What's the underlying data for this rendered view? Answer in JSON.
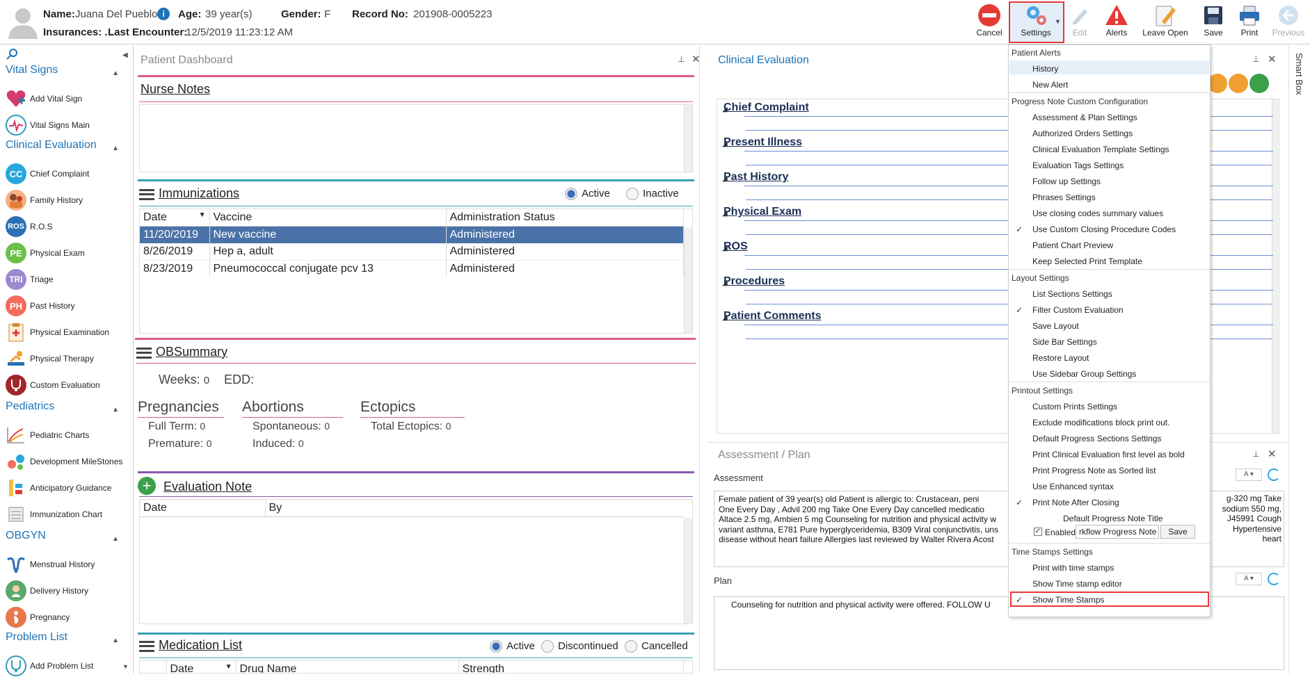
{
  "header": {
    "name_label": "Name:",
    "name_value": "Juana Del Pueblo",
    "age_label": "Age:",
    "age_value": "39 year(s)",
    "gender_label": "Gender:",
    "gender_value": "F",
    "record_label": "Record No:",
    "record_value": "201908-0005223",
    "insurances_label": "Insurances: . .",
    "last_encounter_label": "Last Encounter:",
    "last_encounter_value": "12/5/2019 11:23:12 AM"
  },
  "toolbar": {
    "cancel": "Cancel",
    "settings": "Settings",
    "edit": "Edit",
    "alerts": "Alerts",
    "leave_open": "Leave Open",
    "save": "Save",
    "print": "Print",
    "previous": "Previous"
  },
  "sidebar": {
    "vital_signs": "Vital Signs",
    "add_vital_sign": "Add Vital Sign",
    "vital_signs_main": "Vital Signs Main",
    "clinical_evaluation": "Clinical Evaluation",
    "chief_complaint": "Chief Complaint",
    "family_history": "Family History",
    "ros": "R.O.S",
    "physical_exam": "Physical Exam",
    "triage": "Triage",
    "past_history": "Past History",
    "physical_examination": "Physical Examination",
    "physical_therapy": "Physical Therapy",
    "custom_evaluation": "Custom Evaluation",
    "pediatrics": "Pediatrics",
    "pediatric_charts": "Pediatric Charts",
    "development_milestones": "Development MileStones",
    "anticipatory_guidance": "Anticipatory Guidance",
    "immunization_chart": "Immunization Chart",
    "obgyn": "OBGYN",
    "menstrual_history": "Menstrual History",
    "delivery_history": "Delivery History",
    "pregnancy": "Pregnancy",
    "problem_list": "Problem List",
    "add_problem_list": "Add Problem List",
    "icon_cc": "CC",
    "icon_ros": "ROS",
    "icon_pe": "PE",
    "icon_tri": "TRI",
    "icon_ph": "PH"
  },
  "dashboard": {
    "title": "Patient Dashboard",
    "nurse_notes": "Nurse Notes",
    "immunizations": "Immunizations",
    "active": "Active",
    "inactive": "Inactive",
    "imm_columns": [
      "Date",
      "Vaccine",
      "Administration Status"
    ],
    "imm_rows": [
      {
        "date": "11/20/2019",
        "vaccine": "New vaccine",
        "status": "Administered"
      },
      {
        "date": "8/26/2019",
        "vaccine": "Hep a, adult",
        "status": "Administered"
      },
      {
        "date": "8/23/2019",
        "vaccine": "Pneumococcal conjugate pcv 13",
        "status": "Administered"
      }
    ],
    "obsummary": "OBSummary",
    "weeks_label": "Weeks:",
    "weeks_value": "0",
    "edd_label": "EDD:",
    "pregnancies": "Pregnancies",
    "full_term_label": "Full Term:",
    "full_term_value": "0",
    "premature_label": "Premature:",
    "premature_value": "0",
    "abortions": "Abortions",
    "spontaneous_label": "Spontaneous:",
    "spontaneous_value": "0",
    "induced_label": "Induced:",
    "induced_value": "0",
    "ectopics": "Ectopics",
    "total_ectopics_label": "Total Ectopics:",
    "total_ectopics_value": "0",
    "evaluation_note": "Evaluation Note",
    "eval_columns": [
      "Date",
      "By"
    ],
    "medication_list": "Medication List",
    "med_active": "Active",
    "med_discontinued": "Discontinued",
    "med_cancelled": "Cancelled",
    "med_columns": [
      "Date",
      "Drug Name",
      "Strength"
    ]
  },
  "clinical_evaluation": {
    "title": "Clinical Evaluation",
    "sections": [
      "Chief Complaint",
      "Present Illness",
      "Past History",
      "Physical Exam",
      "ROS",
      "Procedures",
      "Patient Comments"
    ]
  },
  "assessment_plan": {
    "title": "Assessment / Plan",
    "assessment_label": "Assessment",
    "assessment_text_line1": "Female patient of 39 year(s) old        Patient is allergic to:  Crustacean, peni",
    "assessment_text_line2": "One Every Day , Advil 200 mg Take One Every Day       cancelled medicatio",
    "assessment_text_line3": "Altace 2.5 mg, Ambien 5 mg   Counseling for nutrition and physical activity w",
    "assessment_text_line4": "variant asthma, E781 Pure hyperglyceridemia, B309 Viral conjunctivitis, uns",
    "assessment_text_line5": "disease without heart failure  Allergies last reviewed by Walter Rivera Acost",
    "assessment_right_line1": "g-320 mg Take",
    "assessment_right_line2": "sodium 550 mg,",
    "assessment_right_line3": "J45991 Cough",
    "assessment_right_line4": "Hypertensive heart",
    "plan_label": "Plan",
    "plan_text": "Counseling for nutrition and physical activity were offered.     FOLLOW U"
  },
  "smart_box": "Smart Box",
  "settings_menu": {
    "patient_alerts": "Patient Alerts",
    "history": "History",
    "new_alert": "New Alert",
    "progress_note_config": "Progress Note Custom Configuration",
    "assessment_plan_settings": "Assessment & Plan Settings",
    "authorized_orders_settings": "Authorized Orders Settings",
    "clinical_eval_template_settings": "Clinical Evaluation Template Settings",
    "evaluation_tags_settings": "Evaluation Tags Settings",
    "follow_up_settings": "Follow up Settings",
    "phrases_settings": "Phrases Settings",
    "use_closing_codes": "Use closing codes summary values",
    "use_custom_closing": "Use Custom Closing Procedure Codes",
    "patient_chart_preview": "Patient Chart Preview",
    "keep_selected_print": "Keep Selected Print Template",
    "layout_settings": "Layout Settings",
    "list_sections_settings": "List Sections Settings",
    "filter_custom_eval": "Filter Custom Evaluation",
    "save_layout": "Save Layout",
    "side_bar_settings": "Side Bar Settings",
    "restore_layout": "Restore Layout",
    "use_sidebar_group": "Use Sidebar Group Settings",
    "printout_settings": "Printout Settings",
    "custom_prints_settings": "Custom Prints Settings",
    "exclude_modifications": "Exclude modifications block print out.",
    "default_progress_sections": "Default Progress Sections Settings",
    "print_clinical_eval_bold": "Print Clinical Evaluation first level as bold",
    "print_progress_sorted": "Print Progress Note as Sorted list",
    "use_enhanced_syntax": "Use Enhanced syntax",
    "print_note_after_closing": "Print Note After Closing",
    "default_progress_note_title": "Default Progress Note Title",
    "enabled": "Enabled",
    "title_value": "rkflow Progress Note",
    "save": "Save",
    "time_stamps_settings": "Time Stamps Settings",
    "print_with_time_stamps": "Print with time stamps",
    "show_time_stamp_editor": "Show Time stamp editor",
    "show_time_stamps": "Show Time Stamps"
  },
  "colors": {
    "accent_blue": "#1d73b8",
    "selected_row": "#4a72a8",
    "highlight_red": "#e53935",
    "pink_rule": "#e05a8a",
    "teal_rule": "#3aa0b8",
    "purple_rule": "#8a5ab0"
  }
}
